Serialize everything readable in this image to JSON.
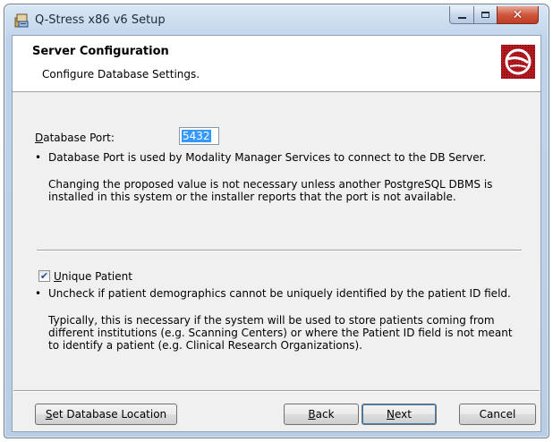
{
  "window": {
    "title": "Q-Stress x86 v6 Setup",
    "caption_buttons": {
      "minimize": "—",
      "maximize": "☐",
      "close": "✕"
    }
  },
  "header": {
    "title": "Server Configuration",
    "subtitle": "Configure Database Settings.",
    "logo_icon": "disc-logo-icon"
  },
  "db_port": {
    "label_accel": "D",
    "label_rest": "atabase Port:",
    "value": "5432",
    "bullet": "•",
    "info_1": "Database Port is used by Modality Manager Services to connect to the DB Server.",
    "info_2": "Changing the proposed value is not necessary unless another PostgreSQL DBMS is installed in this system or the installer reports that the port is not available."
  },
  "unique_patient": {
    "checked": true,
    "check_glyph": "✔",
    "label_accel": "U",
    "label_rest": "nique Patient",
    "bullet": "•",
    "info_1": "Uncheck if patient demographics cannot be uniquely identified by the patient ID field.",
    "info_2": "Typically, this is necessary if the system will be used to store patients coming from different institutions (e.g. Scanning Centers) or where the Patient ID field is not meant to identify a patient (e.g. Clinical Research Organizations)."
  },
  "buttons": {
    "set_location_accel": "S",
    "set_location_rest": "et Database Location",
    "back_accel": "B",
    "back_rest": "ack",
    "next_accel": "N",
    "next_rest": "ext",
    "cancel": "Cancel"
  },
  "colors": {
    "selection": "#3399ff",
    "close_button": "#c13b23",
    "client_bg": "#f0f0f0"
  }
}
